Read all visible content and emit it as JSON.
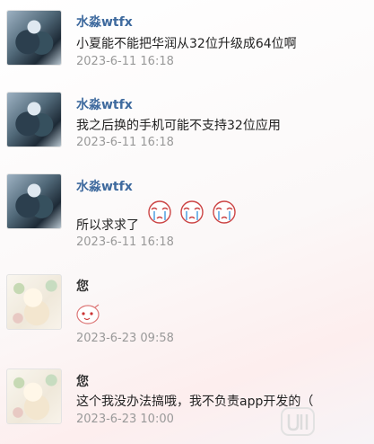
{
  "messages": [
    {
      "sender": "水淼wtfx",
      "text": "小夏能不能把华润从32位升级成64位啊",
      "time": "2023-6-11 16:18",
      "avatar": "anime-avatar-dark"
    },
    {
      "sender": "水淼wtfx",
      "text": "我之后换的手机可能不支持32位应用",
      "time": "2023-6-11 16:18",
      "avatar": "anime-avatar-dark"
    },
    {
      "sender": "水淼wtfx",
      "text": "所以求求了",
      "emojis": [
        "crying-sticker",
        "crying-sticker",
        "crying-sticker"
      ],
      "time": "2023-6-11 16:18",
      "avatar": "anime-avatar-dark"
    },
    {
      "sender": "您",
      "emoji": "smiley-sticker",
      "time": "2023-6-23 09:58",
      "avatar": "anime-avatar-light"
    },
    {
      "sender": "您",
      "text": "这个我没办法搞哦，我不负责app开发的（",
      "time": "2023-6-23 10:00",
      "avatar": "anime-avatar-light"
    }
  ],
  "colors": {
    "sender_name": "#3e6a9e",
    "self_name": "#333333",
    "timestamp": "#999999",
    "text": "#222222"
  }
}
